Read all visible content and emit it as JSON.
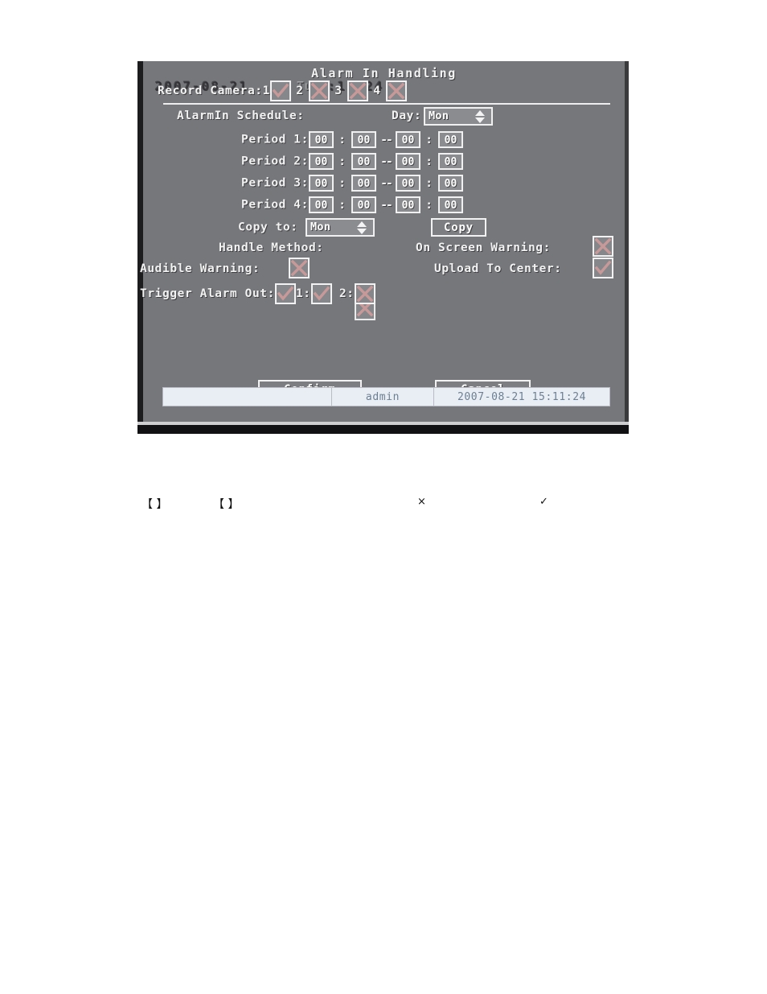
{
  "figure": {
    "title": "Alarm In Handling",
    "record_camera": {
      "label": "Record Camera:",
      "items": [
        {
          "num": "1",
          "state": "check"
        },
        {
          "num": "2",
          "state": "cross"
        },
        {
          "num": "3",
          "state": "cross"
        },
        {
          "num": "4",
          "state": "cross"
        }
      ]
    },
    "schedule": {
      "label": "AlarmIn Schedule:",
      "day_label": "Day:",
      "day_value": "Mon",
      "periods": [
        {
          "label": "Period 1:",
          "start_h": "00",
          "start_m": "00",
          "end_h": "00",
          "end_m": "00"
        },
        {
          "label": "Period 2:",
          "start_h": "00",
          "start_m": "00",
          "end_h": "00",
          "end_m": "00"
        },
        {
          "label": "Period 3:",
          "start_h": "00",
          "start_m": "00",
          "end_h": "00",
          "end_m": "00"
        },
        {
          "label": "Period 4:",
          "start_h": "00",
          "start_m": "00",
          "end_h": "00",
          "end_m": "00"
        }
      ],
      "time_sep": ":",
      "range_sep": "--"
    },
    "copy": {
      "label": "Copy to:",
      "value": "Mon",
      "button": "Copy"
    },
    "handle": {
      "label": "Handle Method:",
      "on_screen_warning_label": "On Screen Warning:",
      "on_screen_warning_state": "cross",
      "audible_warning_label": "Audible Warning:",
      "audible_warning_state": "cross",
      "upload_to_center_label": "Upload To Center:",
      "upload_to_center_state": "check",
      "trigger_alarm_out_label": "Trigger Alarm Out:",
      "trigger_alarm_out_state": "check",
      "out1_label": "1:",
      "out1_state": "check",
      "out2_label": "2:",
      "out2_state": "cross"
    },
    "buttons": {
      "confirm": "Confirm",
      "cancel": "Cancel"
    },
    "statusbar": {
      "left": "",
      "user": "admin",
      "datetime": "2007-08-21 15:11:24"
    },
    "ghosts": {
      "date_overlay": "2007-08-21",
      "time_overlay": "15:11:24",
      "camera_overlay": "Camera 01",
      "tue_overlay": "Tue"
    },
    "colors": {
      "osd_background": "#76777b",
      "osd_text": "#f2f2f2",
      "box_border": "#f0f0f1",
      "mark": "#c79a99",
      "statusbar_bg": "#e8eef4",
      "statusbar_text": "#6d7f93"
    }
  },
  "caption": {
    "bracket_a": "【    】",
    "bracket_b": "【    】",
    "cross_glyph": "×",
    "check_glyph": "✓"
  }
}
